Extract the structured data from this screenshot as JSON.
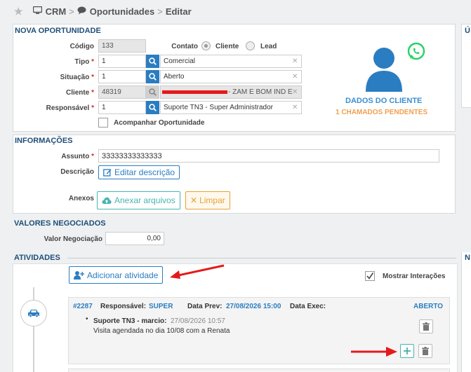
{
  "breadcrumb": {
    "crm": "CRM",
    "oportunidades": "Oportunidades",
    "editar": "Editar",
    "sep": ">"
  },
  "nova": {
    "title": "NOVA OPORTUNIDADE",
    "codigo_label": "Código",
    "codigo_value": "133",
    "contato_label": "Contato",
    "cliente_radio": "Cliente",
    "lead_radio": "Lead",
    "tipo_label": "Tipo",
    "tipo_id": "1",
    "tipo_value": "Comercial",
    "situacao_label": "Situação",
    "situacao_id": "1",
    "situacao_value": "Aberto",
    "cliente_label": "Cliente",
    "cliente_id": "48319",
    "cliente_value_suffix": "- ZAM E BOM IND E",
    "responsavel_label": "Responsável",
    "responsavel_id": "1",
    "responsavel_value": "Suporte TN3 - Super Administrador",
    "acompanhar_label": "Acompanhar Oportunidade",
    "required_mark": "*"
  },
  "cliente_card": {
    "title": "DADOS DO CLIENTE",
    "pendentes": "1 CHAMADOS PENDENTES"
  },
  "informacoes": {
    "title": "INFORMAÇÕES",
    "assunto_label": "Assunto",
    "assunto_value": "33333333333333",
    "descricao_label": "Descrição",
    "editar_btn": "Editar descrição",
    "anexos_label": "Anexos",
    "anexar_btn": "Anexar arquivos",
    "limpar_btn": "Limpar"
  },
  "valores": {
    "title": "VALORES NEGOCIADOS",
    "valor_label": "Valor Negociação",
    "valor_value": "0,00"
  },
  "atividades": {
    "title": "ATIVIDADES",
    "add_btn": "Adicionar atividade",
    "mostrar_label": "Mostrar Interações",
    "card": {
      "id": "#2287",
      "resp_label": "Responsável:",
      "resp_value": "SUPER",
      "prev_label": "Data Prev:",
      "prev_value": "27/08/2026 15:00",
      "exec_label": "Data Exec:",
      "status": "ABERTO",
      "interaction_author": "Suporte TN3 - marcio:",
      "interaction_date": "27/08/2026 10:57",
      "interaction_text": "Visita agendada no dia 10/08 com a Renata"
    }
  },
  "right_cut": {
    "top_letter": "Ú",
    "mid_letter": "N"
  },
  "colors": {
    "brand_blue": "#1f4e79",
    "accent_blue": "#2a7dc1",
    "status_blue": "#3a8fd1",
    "pending_orange": "#f0a050",
    "whatsapp_green": "#25d366",
    "red": "#e5191b"
  }
}
